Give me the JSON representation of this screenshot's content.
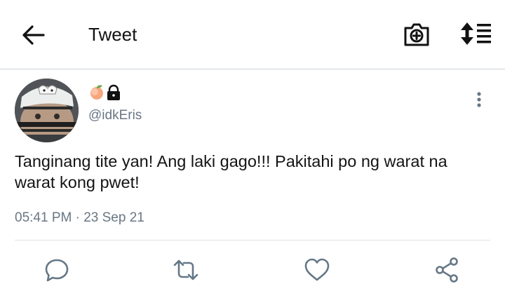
{
  "header": {
    "title": "Tweet",
    "icons": [
      "back-arrow-icon",
      "camera-plus-icon",
      "sort-list-icon"
    ]
  },
  "tweet": {
    "name_emojis": [
      "peach-emoji",
      "lock-icon"
    ],
    "handle": "@idkEris",
    "text": "Tanginang tite yan! Ang laki gago!!! Pakitahi po ng warat na warat kong pwet!",
    "time": "05:41 PM",
    "separator": "·",
    "date": "23 Sep 21"
  },
  "actions": [
    "reply-icon",
    "retweet-icon",
    "like-icon",
    "share-icon"
  ],
  "colors": {
    "icon_gray": "#657786",
    "text": "#141414",
    "meta": "#687684",
    "divider": "#dfe3e6"
  }
}
